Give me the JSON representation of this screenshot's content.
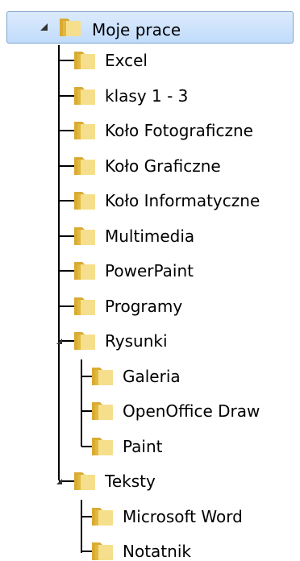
{
  "colors": {
    "selection_top": "#dcebfc",
    "selection_bottom": "#c1dcfc",
    "selection_border": "#7da2ce",
    "folder": "#e8c250",
    "tree_line": "#000000"
  },
  "tree": {
    "root": {
      "label": "Moje prace",
      "expanded": true,
      "selected": true,
      "icon": "folder-icon"
    },
    "items": [
      {
        "label": "Excel",
        "icon": "folder-icon"
      },
      {
        "label": "klasy 1 - 3",
        "icon": "folder-icon"
      },
      {
        "label": "Koło Fotograficzne",
        "icon": "folder-icon"
      },
      {
        "label": "Koło Graficzne",
        "icon": "folder-icon"
      },
      {
        "label": "Koło Informatyczne",
        "icon": "folder-icon"
      },
      {
        "label": "Multimedia",
        "icon": "folder-icon"
      },
      {
        "label": "PowerPaint",
        "icon": "folder-icon"
      },
      {
        "label": "Programy",
        "icon": "folder-icon"
      },
      {
        "label": "Rysunki",
        "icon": "folder-icon",
        "expanded": true,
        "children": [
          {
            "label": "Galeria",
            "icon": "folder-icon"
          },
          {
            "label": "OpenOffice Draw",
            "icon": "folder-icon"
          },
          {
            "label": "Paint",
            "icon": "folder-icon"
          }
        ]
      },
      {
        "label": "Teksty",
        "icon": "folder-icon",
        "expanded": true,
        "children": [
          {
            "label": "Microsoft Word",
            "icon": "folder-icon"
          },
          {
            "label": "Notatnik",
            "icon": "folder-icon"
          }
        ]
      }
    ]
  }
}
